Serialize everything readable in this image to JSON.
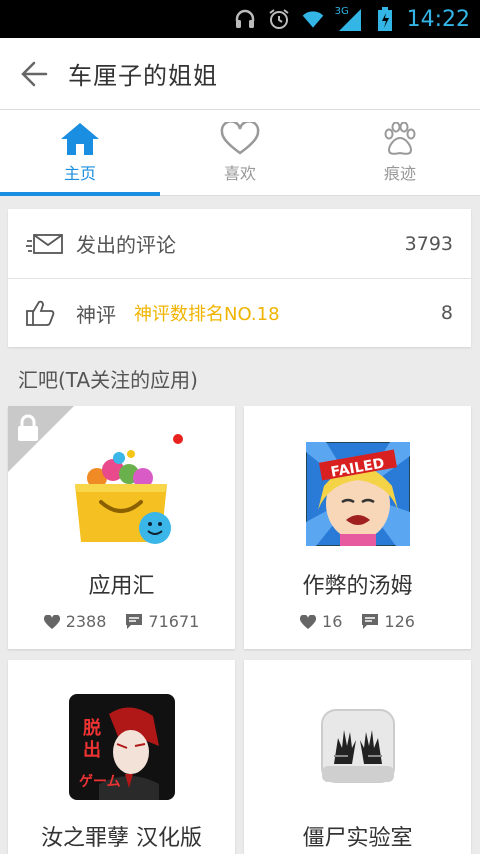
{
  "status_bar": {
    "time": "14:22",
    "network": "3G"
  },
  "app_bar": {
    "title": "车厘子的姐姐"
  },
  "tabs": [
    {
      "label": "主页",
      "icon": "home-icon",
      "active": true
    },
    {
      "label": "喜欢",
      "icon": "heart-icon",
      "active": false
    },
    {
      "label": "痕迹",
      "icon": "paw-icon",
      "active": false
    }
  ],
  "stats_rows": [
    {
      "label": "发出的评论",
      "badge": "",
      "value": "3793",
      "icon": "mail-icon"
    },
    {
      "label": "神评",
      "badge": "神评数排名NO.18",
      "value": "8",
      "icon": "thumbs-up-icon"
    }
  ],
  "section": {
    "title": "汇吧(TA关注的应用)"
  },
  "apps": [
    {
      "name": "应用汇",
      "likes": "2388",
      "comments": "71671",
      "locked": true,
      "new": true
    },
    {
      "name": "作弊的汤姆",
      "likes": "16",
      "comments": "126",
      "locked": false,
      "new": false
    },
    {
      "name": "汝之罪孽 汉化版",
      "likes": "",
      "comments": "",
      "locked": false,
      "new": false
    },
    {
      "name": "僵尸实验室",
      "likes": "",
      "comments": "",
      "locked": false,
      "new": false
    }
  ],
  "colors": {
    "accent": "#1a8ee0",
    "badge": "#f0b400",
    "status_icons": "#33b5e5"
  }
}
